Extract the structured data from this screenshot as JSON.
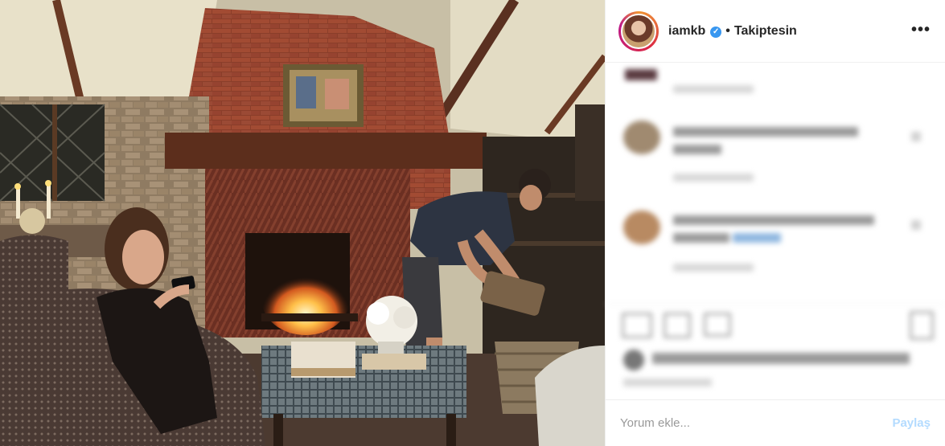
{
  "post": {
    "username": "iamkb",
    "verified_glyph": "✓",
    "separator": "•",
    "follow_status": "Takiptesin",
    "more_glyph": "•••"
  },
  "footer": {
    "comment_placeholder": "Yorum ekle...",
    "share_label": "Paylaş"
  },
  "icons": [
    "verified-icon",
    "more-options-icon",
    "like-icon",
    "comment-icon",
    "share-icon",
    "bookmark-icon"
  ],
  "colors": {
    "verified": "#3897f0",
    "share_disabled": "#b3dbff",
    "placeholder": "#999999"
  }
}
